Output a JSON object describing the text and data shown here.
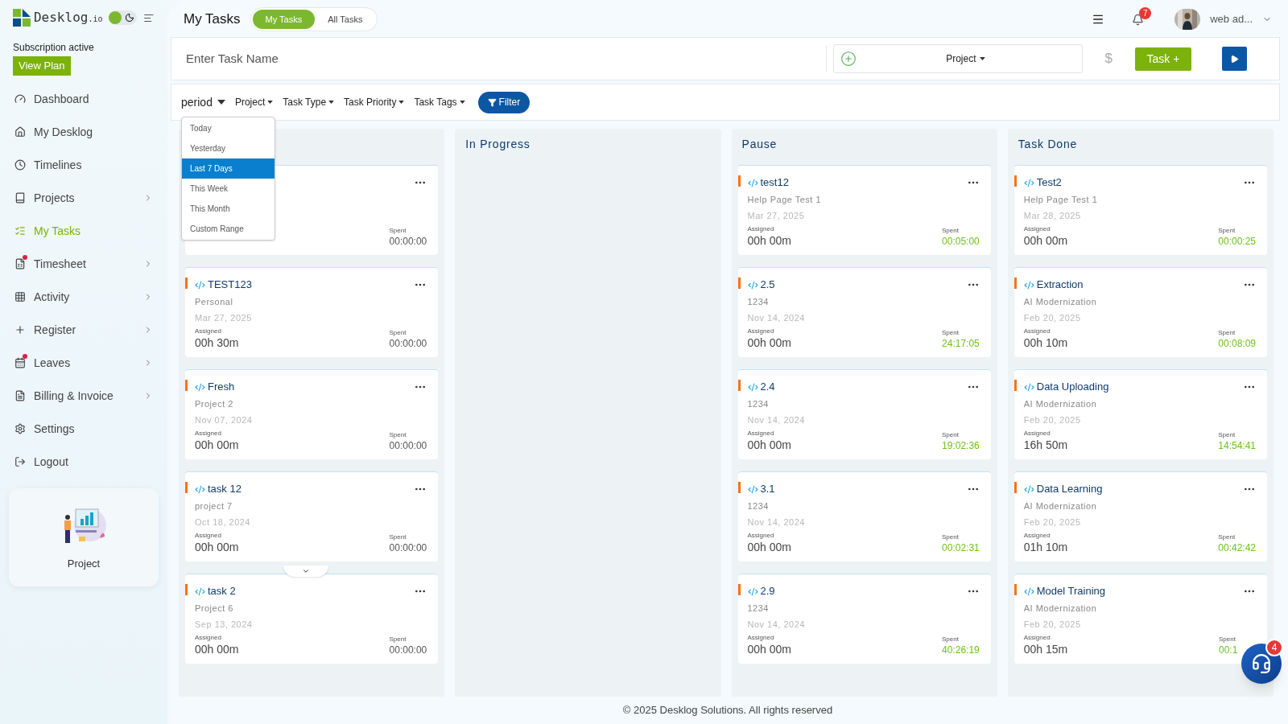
{
  "logo": {
    "name": "Desklog",
    "suffix": ".io"
  },
  "theme": {
    "dark_mode": false
  },
  "subscription": {
    "status": "Subscription active",
    "button": "View Plan"
  },
  "sidebar": {
    "items": [
      {
        "kind": "dashboard",
        "label": "Dashboard",
        "selected": false,
        "submenu": false,
        "notification": false
      },
      {
        "kind": "home",
        "label": "My Desklog",
        "selected": false,
        "submenu": false,
        "notification": false
      },
      {
        "kind": "clock",
        "label": "Timelines",
        "selected": false,
        "submenu": false,
        "notification": false
      },
      {
        "kind": "book",
        "label": "Projects",
        "selected": false,
        "submenu": true,
        "notification": false
      },
      {
        "kind": "tasks",
        "label": "My Tasks",
        "selected": true,
        "submenu": false,
        "notification": false
      },
      {
        "kind": "sheet",
        "label": "Timesheet",
        "selected": false,
        "submenu": true,
        "notification": true
      },
      {
        "kind": "grid",
        "label": "Activity",
        "selected": false,
        "submenu": true,
        "notification": false
      },
      {
        "kind": "plus",
        "label": "Register",
        "selected": false,
        "submenu": true,
        "notification": false
      },
      {
        "kind": "calendar",
        "label": "Leaves",
        "selected": false,
        "submenu": true,
        "notification": true
      },
      {
        "kind": "file",
        "label": "Billing & Invoice",
        "selected": false,
        "submenu": true,
        "notification": false
      },
      {
        "kind": "settings",
        "label": "Settings",
        "selected": false,
        "submenu": false,
        "notification": false
      },
      {
        "kind": "logout",
        "label": "Logout",
        "selected": false,
        "submenu": false,
        "notification": false
      }
    ],
    "promo": {
      "label": "Project"
    }
  },
  "header": {
    "title": "My Tasks",
    "tabs": [
      {
        "label": "My Tasks",
        "selected": true
      },
      {
        "label": "All Tasks",
        "selected": false
      }
    ],
    "notifications": "7",
    "user": "web ad..."
  },
  "task_bar": {
    "placeholder": "Enter Task Name",
    "project": "Project",
    "currency": "$",
    "add_button": "Task +"
  },
  "filters": {
    "period": "period",
    "dropdowns": [
      "Project",
      "Task Type",
      "Task Priority",
      "Task Tags"
    ],
    "button": "Filter",
    "period_menu": [
      {
        "label": "Today",
        "selected": false
      },
      {
        "label": "Yesterday",
        "selected": false
      },
      {
        "label": "Last 7 Days",
        "selected": true
      },
      {
        "label": "This Week",
        "selected": false
      },
      {
        "label": "This Month",
        "selected": false
      },
      {
        "label": "Custom Range",
        "selected": false
      }
    ]
  },
  "columns": [
    {
      "cards": [
        {
          "spent_label": "Spent",
          "spent": "00:00:00",
          "tracked": false
        },
        {
          "name": "TEST123",
          "project": "Personal",
          "date": "Mar 27, 2025",
          "assigned_label": "Assigned",
          "assigned": "00h 30m",
          "spent_label": "Spent",
          "spent": "00:00:00",
          "tracked": false
        },
        {
          "name": "Fresh",
          "project": "Project 2",
          "date": "Nov 07, 2024",
          "assigned_label": "Assigned",
          "assigned": "00h 00m",
          "spent_label": "Spent",
          "spent": "00:00:00",
          "tracked": false
        },
        {
          "name": "task 12",
          "project": "project 7",
          "date": "Oct 18, 2024",
          "assigned_label": "Assigned",
          "assigned": "00h 00m",
          "spent_label": "Spent",
          "spent": "00:00:00",
          "tracked": false
        },
        {
          "name": "task 2",
          "project": "Project 6",
          "date": "Sep 13, 2024",
          "assigned_label": "Assigned",
          "assigned": "00h 00m",
          "spent_label": "Spent",
          "spent": "00:00:00",
          "tracked": false
        }
      ]
    },
    {
      "title": "In Progress"
    },
    {
      "title": "Pause",
      "cards": [
        {
          "name": "test12",
          "project": "Help Page Test 1",
          "date": "Mar 27, 2025",
          "assigned_label": "Assigned",
          "assigned": "00h 00m",
          "spent_label": "Spent",
          "spent": "00:05:00",
          "tracked": true
        },
        {
          "name": "2.5",
          "project": "1234",
          "date": "Nov 14, 2024",
          "assigned_label": "Assigned",
          "assigned": "00h 00m",
          "spent_label": "Spent",
          "spent": "24:17:05",
          "tracked": true
        },
        {
          "name": "2.4",
          "project": "1234",
          "date": "Nov 14, 2024",
          "assigned_label": "Assigned",
          "assigned": "00h 00m",
          "spent_label": "Spent",
          "spent": "19:02:36",
          "tracked": true
        },
        {
          "name": "3.1",
          "project": "1234",
          "date": "Nov 14, 2024",
          "assigned_label": "Assigned",
          "assigned": "00h 00m",
          "spent_label": "Spent",
          "spent": "00:02:31",
          "tracked": true
        },
        {
          "name": "2.9",
          "project": "1234",
          "date": "Nov 14, 2024",
          "assigned_label": "Assigned",
          "assigned": "00h 00m",
          "spent_label": "Spent",
          "spent": "40:26:19",
          "tracked": true
        }
      ]
    },
    {
      "title": "Task Done",
      "cards": [
        {
          "name": "Test2",
          "project": "Help Page Test 1",
          "date": "Mar 28, 2025",
          "assigned_label": "Assigned",
          "assigned": "00h 00m",
          "spent_label": "Spent",
          "spent": "00:00:25",
          "tracked": true
        },
        {
          "name": "Extraction",
          "project": "AI Modernization",
          "date": "Feb 20, 2025",
          "assigned_label": "Assigned",
          "assigned": "00h 10m",
          "spent_label": "Spent",
          "spent": "00:08:09",
          "tracked": true
        },
        {
          "name": "Data Uploading",
          "project": "AI Modernization",
          "date": "Feb 20, 2025",
          "assigned_label": "Assigned",
          "assigned": "16h 50m",
          "spent_label": "Spent",
          "spent": "14:54:41",
          "tracked": true
        },
        {
          "name": "Data Learning",
          "project": "AI Modernization",
          "date": "Feb 20, 2025",
          "assigned_label": "Assigned",
          "assigned": "01h 10m",
          "spent_label": "Spent",
          "spent": "00:42:42",
          "tracked": true
        },
        {
          "name": "Model Training",
          "project": "AI Modernization",
          "date": "Feb 20, 2025",
          "assigned_label": "Assigned",
          "assigned": "00h 15m",
          "spent_label": "Spent",
          "spent": "00:1",
          "tracked": true
        }
      ]
    }
  ],
  "chat": {
    "badge": "4"
  },
  "footer": "© 2025 Desklog Solutions. All rights reserved"
}
